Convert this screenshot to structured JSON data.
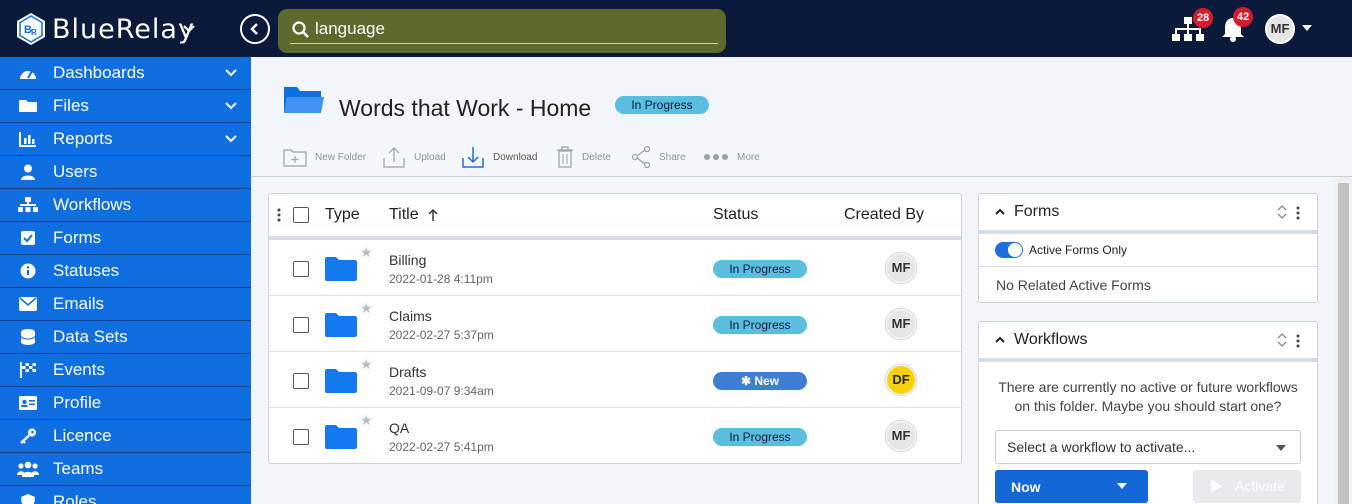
{
  "topbar": {
    "brand": "BlueRelay",
    "search_value": "language",
    "network_badge": "28",
    "notification_badge": "42",
    "user_initials": "MF"
  },
  "sidebar": {
    "items": [
      {
        "label": "Dashboards",
        "icon": "gauge-icon",
        "expandable": true
      },
      {
        "label": "Files",
        "icon": "folder-icon",
        "expandable": true
      },
      {
        "label": "Reports",
        "icon": "bar-chart-icon",
        "expandable": true
      },
      {
        "label": "Users",
        "icon": "user-icon",
        "expandable": false
      },
      {
        "label": "Workflows",
        "icon": "sitemap-icon",
        "expandable": false
      },
      {
        "label": "Forms",
        "icon": "check-square-icon",
        "expandable": false
      },
      {
        "label": "Statuses",
        "icon": "info-icon",
        "expandable": false
      },
      {
        "label": "Emails",
        "icon": "envelope-icon",
        "expandable": false
      },
      {
        "label": "Data Sets",
        "icon": "database-icon",
        "expandable": false
      },
      {
        "label": "Events",
        "icon": "flag-checkered-icon",
        "expandable": false
      },
      {
        "label": "Profile",
        "icon": "id-card-icon",
        "expandable": false
      },
      {
        "label": "Licence",
        "icon": "key-icon",
        "expandable": false
      },
      {
        "label": "Teams",
        "icon": "users-icon",
        "expandable": false
      },
      {
        "label": "Roles",
        "icon": "shield-icon",
        "expandable": false
      }
    ]
  },
  "page": {
    "title": "Words that Work - Home",
    "status": "In Progress"
  },
  "toolbar": {
    "new_folder": "New Folder",
    "upload": "Upload",
    "download": "Download",
    "delete": "Delete",
    "share": "Share",
    "more": "More"
  },
  "table": {
    "columns": {
      "type": "Type",
      "title": "Title",
      "status": "Status",
      "created_by": "Created By"
    },
    "rows": [
      {
        "name": "Billing",
        "date": "2022-01-28 4:11pm",
        "status": "In Progress",
        "created_by": "MF"
      },
      {
        "name": "Claims",
        "date": "2022-02-27 5:37pm",
        "status": "In Progress",
        "created_by": "MF"
      },
      {
        "name": "Drafts",
        "date": "2021-09-07 9:34am",
        "status": "New",
        "created_by": "DF"
      },
      {
        "name": "QA",
        "date": "2022-02-27 5:41pm",
        "status": "In Progress",
        "created_by": "MF"
      }
    ]
  },
  "forms_panel": {
    "title": "Forms",
    "toggle_label": "Active Forms Only",
    "empty_text": "No Related Active Forms"
  },
  "workflows_panel": {
    "title": "Workflows",
    "message": "There are currently no active or future workflows on this folder. Maybe you should start one?",
    "select_placeholder": "Select a workflow to activate...",
    "now_label": "Now",
    "activate_label": "Activate"
  },
  "colors": {
    "topbar": "#0b1a3a",
    "sidebar": "#0f6fe0",
    "search": "#5c6a2c",
    "badge": "#d81b2b",
    "status_in_progress": "#5bbde0",
    "status_new": "#3c7fd1",
    "primary_button": "#1467d7"
  }
}
